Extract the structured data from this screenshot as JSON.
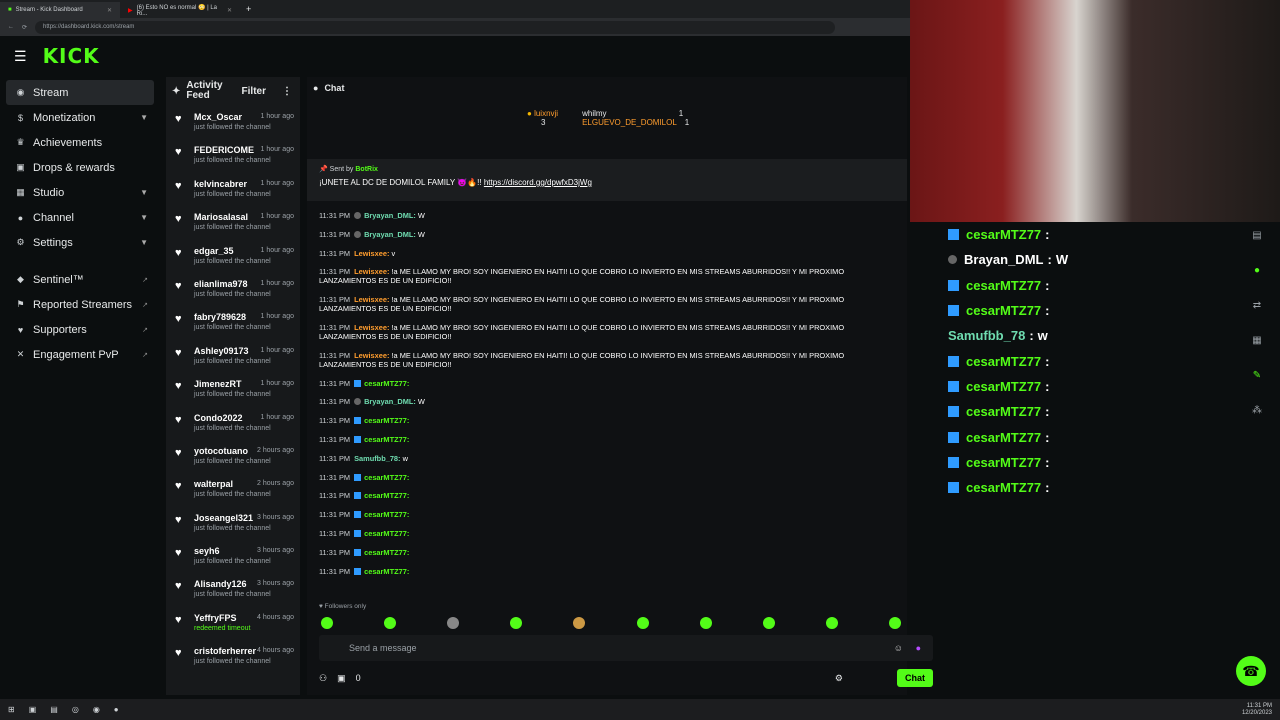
{
  "browser": {
    "tabs": [
      {
        "label": "Stream - Kick Dashboard"
      },
      {
        "label": "(6) Esto NO es normal 😳 | La Ri..."
      }
    ],
    "url": "https://dashboard.kick.com/stream"
  },
  "brand": {
    "logo": "KICK",
    "accent": "#53fc18"
  },
  "sidebar": {
    "items": [
      {
        "label": "Stream",
        "icon": "broadcast-icon"
      },
      {
        "label": "Monetization",
        "icon": "dollar-icon"
      },
      {
        "label": "Achievements",
        "icon": "trophy-icon"
      },
      {
        "label": "Drops & rewards",
        "icon": "gift-icon"
      },
      {
        "label": "Studio",
        "icon": "film-icon"
      },
      {
        "label": "Channel",
        "icon": "person-icon"
      },
      {
        "label": "Settings",
        "icon": "gear-icon"
      }
    ],
    "external": [
      {
        "label": "Sentinel™"
      },
      {
        "label": "Reported Streamers"
      },
      {
        "label": "Supporters"
      },
      {
        "label": "Engagement PvP"
      }
    ]
  },
  "activity": {
    "title": "Activity Feed",
    "filter": "Filter",
    "items": [
      {
        "name": "Mcx_Oscar",
        "time": "1 hour ago",
        "desc": "just followed the channel"
      },
      {
        "name": "FEDERICOME",
        "time": "1 hour ago",
        "desc": "just followed the channel"
      },
      {
        "name": "kelvincabrer",
        "time": "1 hour ago",
        "desc": "just followed the channel"
      },
      {
        "name": "Mariosalasal",
        "time": "1 hour ago",
        "desc": "just followed the channel"
      },
      {
        "name": "edgar_35",
        "time": "1 hour ago",
        "desc": "just followed the channel"
      },
      {
        "name": "elianlima978",
        "time": "1 hour ago",
        "desc": "just followed the channel"
      },
      {
        "name": "fabry789628",
        "time": "1 hour ago",
        "desc": "just followed the channel"
      },
      {
        "name": "Ashley09173",
        "time": "1 hour ago",
        "desc": "just followed the channel"
      },
      {
        "name": "JimenezRT",
        "time": "1 hour ago",
        "desc": "just followed the channel"
      },
      {
        "name": "Condo2022",
        "time": "1 hour ago",
        "desc": "just followed the channel"
      },
      {
        "name": "yotocotuano",
        "time": "2 hours ago",
        "desc": "just followed the channel"
      },
      {
        "name": "walterpal",
        "time": "2 hours ago",
        "desc": "just followed the channel"
      },
      {
        "name": "Joseangel321",
        "time": "3 hours ago",
        "desc": "just followed the channel"
      },
      {
        "name": "seyh6",
        "time": "3 hours ago",
        "desc": "just followed the channel"
      },
      {
        "name": "Alisandy126",
        "time": "3 hours ago",
        "desc": "just followed the channel"
      },
      {
        "name": "YeffryFPS",
        "time": "4 hours ago",
        "desc": "redeemed timeout",
        "green": true
      },
      {
        "name": "cristoferherrer",
        "time": "4 hours ago",
        "desc": "just followed the channel"
      }
    ]
  },
  "chat": {
    "title": "Chat",
    "leaderboard": [
      {
        "name": "luixnvji",
        "count": "3"
      },
      {
        "name": "whilmy",
        "count": "1"
      },
      {
        "name": "ELGUEVO_DE_DOMILOL",
        "count": "1"
      }
    ],
    "pinned": {
      "sent_by": "Sent by",
      "author": "BotRix",
      "message": "¡UNETE AL DC DE DOMILOL FAMILY 😈🔥!!",
      "link": "https://discord.gg/dpwfxD3jWg"
    },
    "messages": [
      {
        "time": "11:31 PM",
        "user": "Bryayan_DML:",
        "text": "W",
        "color": "teal",
        "badge": "grey"
      },
      {
        "time": "11:31 PM",
        "user": "Bryayan_DML:",
        "text": "W",
        "color": "teal",
        "badge": "grey"
      },
      {
        "time": "11:31 PM",
        "user": "Lewisxee:",
        "text": "v",
        "color": "orange"
      },
      {
        "time": "11:31 PM",
        "user": "Lewisxee:",
        "text": "!a ME LLAMO MY BRO! SOY INGENIERO EN HAITI! LO QUE COBRO LO INVIERTO EN MIS STREAMS ABURRIDOS!! Y MI PROXIMO LANZAMIENTOS ES DE UN EDIFICIO!!",
        "color": "orange"
      },
      {
        "time": "11:31 PM",
        "user": "Lewisxee:",
        "text": "!a ME LLAMO MY BRO! SOY INGENIERO EN HAITI! LO QUE COBRO LO INVIERTO EN MIS STREAMS ABURRIDOS!! Y MI PROXIMO LANZAMIENTOS ES DE UN EDIFICIO!!",
        "color": "orange"
      },
      {
        "time": "11:31 PM",
        "user": "Lewisxee:",
        "text": "!a ME LLAMO MY BRO! SOY INGENIERO EN HAITI! LO QUE COBRO LO INVIERTO EN MIS STREAMS ABURRIDOS!! Y MI PROXIMO LANZAMIENTOS ES DE UN EDIFICIO!!",
        "color": "orange"
      },
      {
        "time": "11:31 PM",
        "user": "Lewisxee:",
        "text": "!a ME LLAMO MY BRO! SOY INGENIERO EN HAITI! LO QUE COBRO LO INVIERTO EN MIS STREAMS ABURRIDOS!! Y MI PROXIMO LANZAMIENTOS ES DE UN EDIFICIO!!",
        "color": "orange"
      },
      {
        "time": "11:31 PM",
        "user": "cesarMTZ77:",
        "text": "",
        "color": "green",
        "badge": "blue"
      },
      {
        "time": "11:31 PM",
        "user": "Bryayan_DML:",
        "text": "W",
        "color": "teal",
        "badge": "grey"
      },
      {
        "time": "11:31 PM",
        "user": "cesarMTZ77:",
        "text": "",
        "color": "green",
        "badge": "blue"
      },
      {
        "time": "11:31 PM",
        "user": "cesarMTZ77:",
        "text": "",
        "color": "green",
        "badge": "blue"
      },
      {
        "time": "11:31 PM",
        "user": "Samufbb_78:",
        "text": "w",
        "color": "teal"
      },
      {
        "time": "11:31 PM",
        "user": "cesarMTZ77:",
        "text": "",
        "color": "green",
        "badge": "blue"
      },
      {
        "time": "11:31 PM",
        "user": "cesarMTZ77:",
        "text": "",
        "color": "green",
        "badge": "blue"
      },
      {
        "time": "11:31 PM",
        "user": "cesarMTZ77:",
        "text": "",
        "color": "green",
        "badge": "blue"
      },
      {
        "time": "11:31 PM",
        "user": "cesarMTZ77:",
        "text": "",
        "color": "green",
        "badge": "blue"
      },
      {
        "time": "11:31 PM",
        "user": "cesarMTZ77:",
        "text": "",
        "color": "green",
        "badge": "blue"
      },
      {
        "time": "11:31 PM",
        "user": "cesarMTZ77:",
        "text": "",
        "color": "green",
        "badge": "blue"
      }
    ],
    "followers_only": "Followers only",
    "input_placeholder": "Send a message",
    "count": "0",
    "send_label": "Chat"
  },
  "overlay": {
    "lines": [
      {
        "user": "cesarMTZ77",
        "text": "",
        "color": "green",
        "badge": "blue"
      },
      {
        "user": "Brayan_DML",
        "text": "W",
        "color": "white",
        "badge": "grey"
      },
      {
        "user": "cesarMTZ77",
        "text": "",
        "color": "green",
        "badge": "blue"
      },
      {
        "user": "cesarMTZ77",
        "text": "",
        "color": "green",
        "badge": "blue"
      },
      {
        "user": "Samufbb_78",
        "text": "w",
        "color": "teal"
      },
      {
        "user": "cesarMTZ77",
        "text": "",
        "color": "green",
        "badge": "blue"
      },
      {
        "user": "cesarMTZ77",
        "text": "",
        "color": "green",
        "badge": "blue"
      },
      {
        "user": "cesarMTZ77",
        "text": "",
        "color": "green",
        "badge": "blue"
      },
      {
        "user": "cesarMTZ77",
        "text": "",
        "color": "green",
        "badge": "blue"
      },
      {
        "user": "cesarMTZ77",
        "text": "",
        "color": "green",
        "badge": "blue"
      },
      {
        "user": "cesarMTZ77",
        "text": "",
        "color": "green",
        "badge": "blue"
      }
    ]
  },
  "taskbar": {
    "time": "11:31 PM",
    "date": "12/20/2023"
  }
}
